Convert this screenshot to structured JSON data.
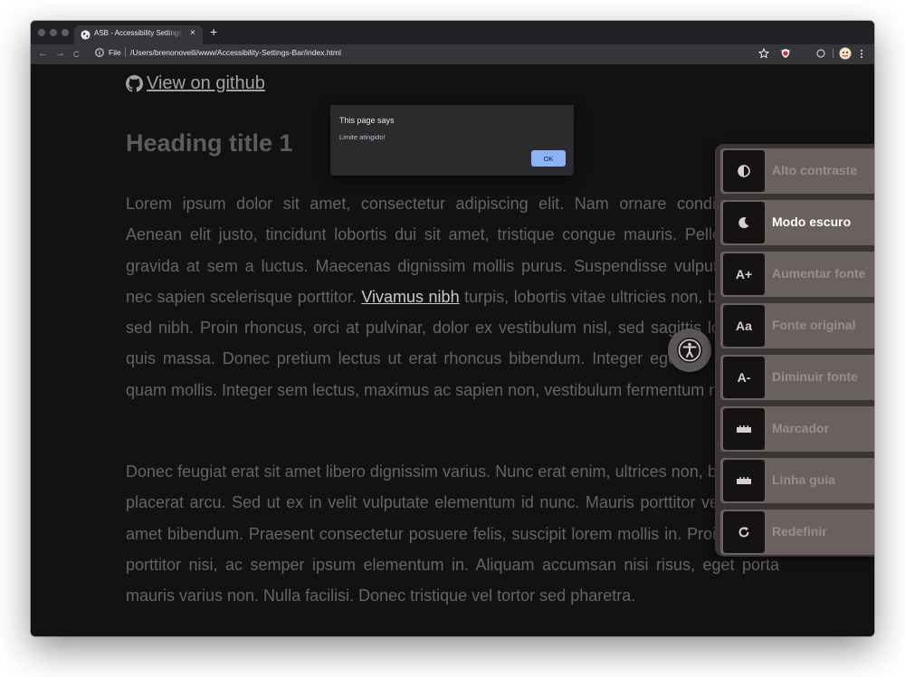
{
  "browser": {
    "tab_title": "ASB - Accessibility Settings Bar",
    "tab_close": "×",
    "new_tab": "+",
    "nav": {
      "back": "←",
      "forward": "→",
      "reload": "C"
    },
    "url_scheme_label": "File",
    "url": "/Users/brenonovelli/www/Accessibility-Settings-Bar/index.html",
    "colors": {
      "tabstrip": "#202124",
      "toolbar": "#35363a"
    }
  },
  "page": {
    "github_link": "View on github",
    "heading": "Heading title 1",
    "paragraph1_before": "Lorem ipsum dolor sit amet, consectetur adipiscing elit. Nam ornare condimentum. Aenean elit justo, tincidunt lobortis dui sit amet, tristique congue mauris. Pellentesque gravida at sem a luctus. Maecenas dignissim mollis purus. Suspendisse vulputate ante nec sapien scelerisque porttitor. ",
    "paragraph1_link": "Vivamus nibh",
    "paragraph1_after": " turpis, lobortis vitae ultricies non, bibendum sed nibh. Proin rhoncus, orci at pulvinar, dolor ex vestibulum nisl, sed sagittis lorem nisl quis massa. Donec pretium lectus ut erat rhoncus bibendum. Integer egestas quam ac quam mollis. Integer sem lectus, maximus ac sapien non, vestibulum fermentum nisi.",
    "paragraph2": "Donec feugiat erat sit amet libero dignissim varius. Nunc erat enim, ultrices non, bibendum placerat arcu. Sed ut ex in velit vulputate elementum id nunc. Mauris porttitor vel velit sit amet bibendum. Praesent consectetur posuere felis, suscipit lorem mollis in. Proin viverra porttitor nisi, ac semper ipsum elementum in. Aliquam accumsan nisi risus, eget porta mauris varius non. Nulla facilisi. Donec tristique vel tortor sed pharetra."
  },
  "dialog": {
    "title": "This page says",
    "message": "Limite atingido!",
    "ok_label": "OK"
  },
  "a11y_panel": {
    "items": [
      {
        "icon": "contrast-icon",
        "label": "Alto contraste",
        "active": false
      },
      {
        "icon": "moon-icon",
        "label": "Modo escuro",
        "active": true
      },
      {
        "icon": "A+",
        "label": "Aumentar fonte",
        "active": false
      },
      {
        "icon": "Aa",
        "label": "Fonte original",
        "active": false
      },
      {
        "icon": "A-",
        "label": "Diminuir fonte",
        "active": false
      },
      {
        "icon": "ruler-icon",
        "label": "Marcador",
        "active": false
      },
      {
        "icon": "ruler-icon",
        "label": "Linha guia",
        "active": false
      },
      {
        "icon": "reset-icon",
        "label": "Redefinir",
        "active": false
      }
    ]
  }
}
